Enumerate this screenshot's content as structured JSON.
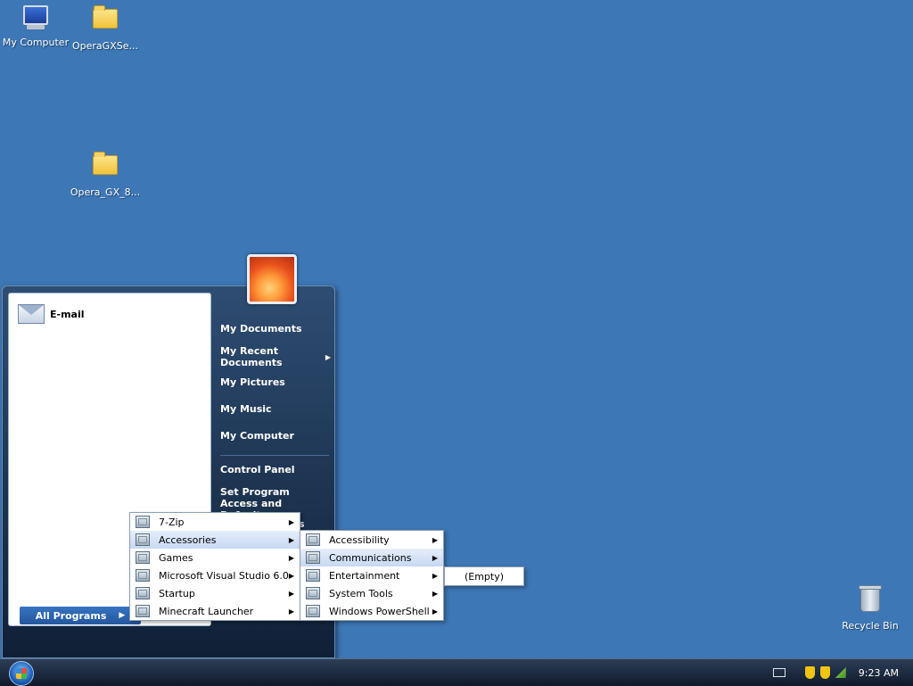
{
  "desktop": {
    "icons": [
      {
        "label": "My Computer",
        "icon": "my-computer-icon"
      },
      {
        "label": "OperaGXSe...",
        "icon": "folder-icon"
      },
      {
        "label": "Opera_GX_8...",
        "icon": "folder-icon"
      },
      {
        "label": "Recycle Bin",
        "icon": "recycle-bin-icon"
      }
    ]
  },
  "start_menu": {
    "pinned": {
      "label": "E-mail",
      "icon": "email-icon"
    },
    "all_programs_label": "All Programs",
    "right_items": [
      {
        "label": "My Documents"
      },
      {
        "label": "My Recent Documents",
        "has_submenu": true
      },
      {
        "label": "My Pictures"
      },
      {
        "label": "My Music"
      },
      {
        "label": "My Computer"
      },
      {
        "label": "Control Panel"
      },
      {
        "label": "Set Program Access and Defaults"
      }
    ],
    "right_partial_text": "s"
  },
  "programs_menu": {
    "items": [
      {
        "label": "7-Zip"
      },
      {
        "label": "Accessories",
        "highlighted": true
      },
      {
        "label": "Games"
      },
      {
        "label": "Microsoft Visual Studio 6.0"
      },
      {
        "label": "Startup"
      },
      {
        "label": "Minecraft Launcher"
      }
    ]
  },
  "accessories_menu": {
    "items": [
      {
        "label": "Accessibility"
      },
      {
        "label": "Communications",
        "highlighted": true
      },
      {
        "label": "Entertainment"
      },
      {
        "label": "System Tools"
      },
      {
        "label": "Windows PowerShell"
      }
    ]
  },
  "entertainment_menu": {
    "items": [
      {
        "label": "(Empty)"
      }
    ]
  },
  "taskbar": {
    "clock": "9:23 AM"
  },
  "colors": {
    "desktop": "#3d77b5",
    "menu_highlight": "#c6d8f2",
    "taskbar": "#1a2638"
  }
}
